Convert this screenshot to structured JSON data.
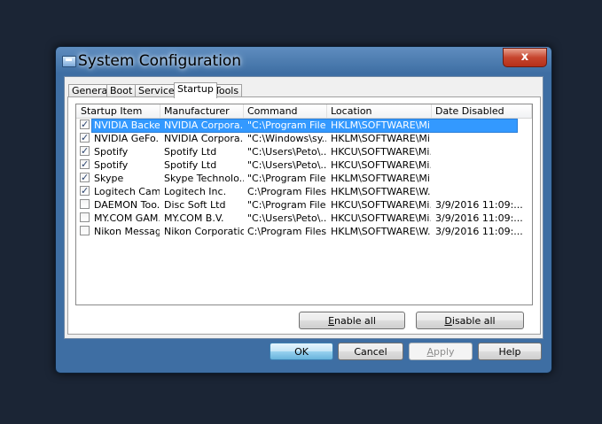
{
  "window": {
    "title": "System Configuration",
    "close_label": "x"
  },
  "tabs": [
    {
      "label": "General",
      "active": false
    },
    {
      "label": "Boot",
      "active": false
    },
    {
      "label": "Services",
      "active": false
    },
    {
      "label": "Startup",
      "active": true
    },
    {
      "label": "Tools",
      "active": false
    }
  ],
  "list": {
    "columns": [
      "Startup Item",
      "Manufacturer",
      "Command",
      "Location",
      "Date Disabled"
    ],
    "rows": [
      {
        "checked": true,
        "selected": true,
        "item": "NVIDIA Backe...",
        "manufacturer": "NVIDIA Corpora...",
        "command": "\"C:\\Program File...",
        "location": "HKLM\\SOFTWARE\\Mi...",
        "date": ""
      },
      {
        "checked": true,
        "selected": false,
        "item": "NVIDIA GeFo...",
        "manufacturer": "NVIDIA Corpora...",
        "command": "\"C:\\Windows\\sy...",
        "location": "HKLM\\SOFTWARE\\Mi...",
        "date": ""
      },
      {
        "checked": true,
        "selected": false,
        "item": "Spotify",
        "manufacturer": "Spotify Ltd",
        "command": "\"C:\\Users\\Peto\\...",
        "location": "HKCU\\SOFTWARE\\Mi...",
        "date": ""
      },
      {
        "checked": true,
        "selected": false,
        "item": "Spotify",
        "manufacturer": "Spotify Ltd",
        "command": "\"C:\\Users\\Peto\\...",
        "location": "HKCU\\SOFTWARE\\Mi...",
        "date": ""
      },
      {
        "checked": true,
        "selected": false,
        "item": "Skype",
        "manufacturer": "Skype Technolo...",
        "command": "\"C:\\Program File...",
        "location": "HKLM\\SOFTWARE\\Mi...",
        "date": ""
      },
      {
        "checked": true,
        "selected": false,
        "item": "Logitech Cam...",
        "manufacturer": "Logitech Inc.",
        "command": "C:\\Program Files...",
        "location": "HKLM\\SOFTWARE\\W...",
        "date": ""
      },
      {
        "checked": false,
        "selected": false,
        "item": "DAEMON Too...",
        "manufacturer": "Disc Soft Ltd",
        "command": "\"C:\\Program File...",
        "location": "HKCU\\SOFTWARE\\Mi...",
        "date": "3/9/2016 11:09:..."
      },
      {
        "checked": false,
        "selected": false,
        "item": "MY.COM GAM...",
        "manufacturer": "MY.COM B.V.",
        "command": "\"C:\\Users\\Peto\\...",
        "location": "HKCU\\SOFTWARE\\Mi...",
        "date": "3/9/2016 11:09:..."
      },
      {
        "checked": false,
        "selected": false,
        "item": "Nikon Messag...",
        "manufacturer": "Nikon Corporation",
        "command": "C:\\Program Files...",
        "location": "HKLM\\SOFTWARE\\W...",
        "date": "3/9/2016 11:09:..."
      }
    ]
  },
  "panel_buttons": {
    "enable_all": {
      "mnemonic": "E",
      "rest": "nable all"
    },
    "disable_all": {
      "mnemonic": "D",
      "rest": "isable all"
    }
  },
  "footer_buttons": {
    "ok": "OK",
    "cancel": "Cancel",
    "apply": {
      "mnemonic": "A",
      "rest": "pply"
    },
    "help": "Help"
  },
  "colors": {
    "selection": "#3399ff",
    "accent_frame": "#3e6ea3",
    "close_button": "#c6452e"
  }
}
